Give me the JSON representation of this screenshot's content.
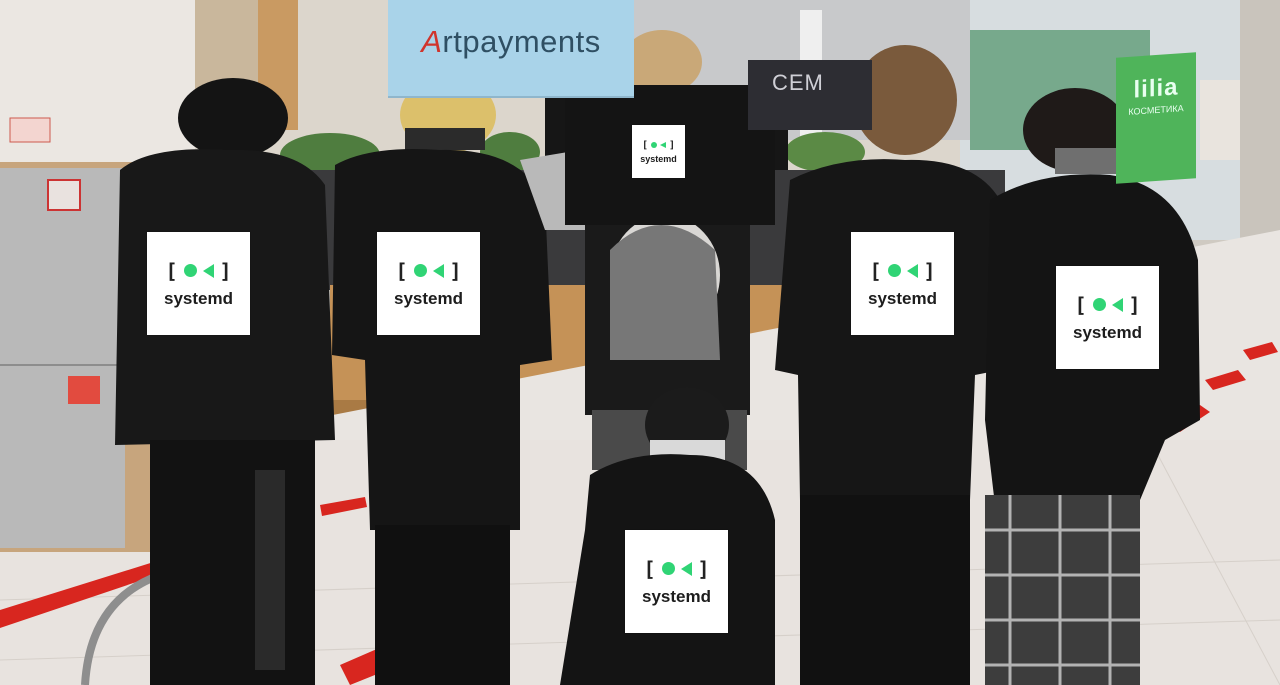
{
  "signs": {
    "artpayments": {
      "brand_accent": "A",
      "brand_rest": "rtpayments"
    },
    "lilia": {
      "line1": "lilia",
      "line2": "КОСМЕТИКА"
    },
    "dark_store": {
      "text": "СЕМ"
    }
  },
  "stickers": [
    {
      "id": "held-shirt",
      "bracket_open": "[",
      "bracket_close": "]",
      "word": "systemd"
    },
    {
      "id": "person-1",
      "bracket_open": "[",
      "bracket_close": "]",
      "word": "systemd"
    },
    {
      "id": "person-2",
      "bracket_open": "[",
      "bracket_close": "]",
      "word": "systemd"
    },
    {
      "id": "person-4",
      "bracket_open": "[",
      "bracket_close": "]",
      "word": "systemd"
    },
    {
      "id": "person-5",
      "bracket_open": "[",
      "bracket_close": "]",
      "word": "systemd"
    },
    {
      "id": "kneeling-person",
      "bracket_open": "[",
      "bracket_close": "]",
      "word": "systemd"
    }
  ],
  "colors": {
    "systemd_green": "#30d475",
    "sticker_bg": "#ffffff",
    "clothing_black": "#151515",
    "floor": "#e8e3df",
    "floor_stripe_red": "#d8261f"
  }
}
